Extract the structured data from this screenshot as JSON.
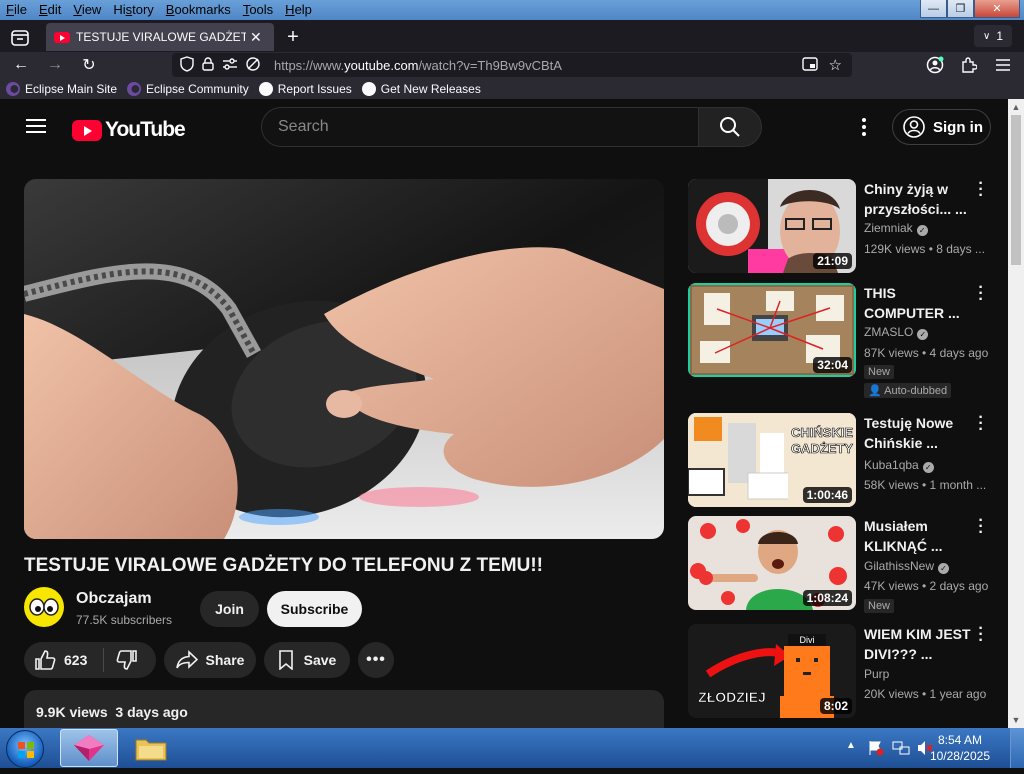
{
  "menu": [
    {
      "label": "File",
      "key": "F"
    },
    {
      "label": "Edit",
      "key": "E"
    },
    {
      "label": "View",
      "key": "V"
    },
    {
      "label": "History",
      "key": "s"
    },
    {
      "label": "Bookmarks",
      "key": "B"
    },
    {
      "label": "Tools",
      "key": "T"
    },
    {
      "label": "Help",
      "key": "H"
    }
  ],
  "window_controls": {
    "minimize": "—",
    "maximize": "❐",
    "close": "✕"
  },
  "tab": {
    "title": "TESTUJE VIRALOWE GADŻETY D",
    "close": "✕",
    "new": "+",
    "count": "1"
  },
  "nav": {
    "back": "←",
    "forward": "→",
    "reload": "↻",
    "url_prefix": "https://www.",
    "url_domain": "youtube.com",
    "url_path": "/watch?v=Th9Bw9vCBtA"
  },
  "bookmarks": [
    {
      "label": "Eclipse Main Site",
      "icon": "eclipse-icon"
    },
    {
      "label": "Eclipse Community",
      "icon": "eclipse-icon"
    },
    {
      "label": "Report Issues",
      "icon": "github-icon"
    },
    {
      "label": "Get New Releases",
      "icon": "github-icon"
    }
  ],
  "youtube": {
    "logo": "YouTube",
    "search_placeholder": "Search",
    "sign_in": "Sign in"
  },
  "video": {
    "title": "TESTUJE VIRALOWE GADŻETY DO TELEFONU Z TEMU!!",
    "channel": "Obczajam",
    "subscribers": "77.5K subscribers",
    "join": "Join",
    "subscribe": "Subscribe",
    "likes": "623",
    "share": "Share",
    "save": "Save",
    "views": "9.9K views",
    "age": "3 days ago"
  },
  "recommendations": [
    {
      "title": "Chiny żyją w przyszłości... ...",
      "channel": "Ziemniak",
      "verified": true,
      "meta": "129K views • 8 days ...",
      "duration": "21:09",
      "badges": []
    },
    {
      "title": "THIS COMPUTER ...",
      "channel": "ZMASLO",
      "verified": true,
      "meta": "87K views • 4 days ago",
      "duration": "32:04",
      "badges": [
        "New",
        "Auto-dubbed"
      ]
    },
    {
      "title": "Testuję Nowe Chińskie ...",
      "channel": "Kuba1qba",
      "verified": true,
      "meta": "58K views • 1 month ...",
      "duration": "1:00:46",
      "badges": []
    },
    {
      "title": "Musiałem KLIKNĄĆ ...",
      "channel": "GilathissNew",
      "verified": true,
      "meta": "47K views • 2 days ago",
      "duration": "1:08:24",
      "badges": [
        "New"
      ]
    },
    {
      "title": "WIEM KIM JEST DIVI??? ...",
      "channel": "Purp",
      "verified": false,
      "meta": "20K views • 1 year ago",
      "duration": "8:02",
      "badges": []
    }
  ],
  "thumb_text": {
    "t3_a": "CHIŃSKIE",
    "t3_b": "GADŻETY",
    "t5_label": "Divi",
    "t5_caption": "ZŁODZIEJ"
  },
  "taskbar": {
    "time": "8:54 AM",
    "date": "10/28/2025"
  }
}
